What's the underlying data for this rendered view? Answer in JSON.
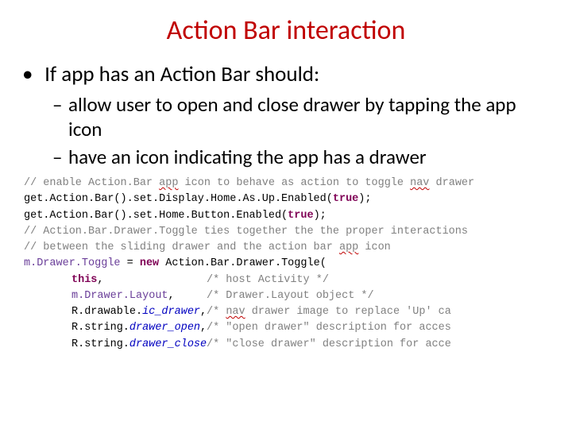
{
  "title": "Action Bar interaction",
  "bullets": {
    "top": "If app has an Action Bar should:",
    "sub": [
      "allow user to open and close drawer by tapping the app icon",
      "have an icon indicating the app has a drawer"
    ]
  },
  "code": {
    "c1a": "// enable Action.Bar ",
    "c1b": "app",
    "c1c": " icon to behave as action to toggle ",
    "c1d": "nav",
    "c1e": " drawer",
    "l2a": "get.Action.Bar().set.Display.Home.As.Up.Enabled(",
    "l2b": "true",
    "l2c": ");",
    "l3a": "get.Action.Bar().set.Home.Button.Enabled(",
    "l3b": "true",
    "l3c": ");",
    "blank": " ",
    "c4": "// Action.Bar.Drawer.Toggle ties together the the proper interactions",
    "c5a": "// between the sliding drawer and the action bar ",
    "c5b": "app",
    "c5c": " icon",
    "l6a": "m.Drawer.Toggle",
    "l6b": " = ",
    "l6c": "new",
    "l6d": " Action.Bar.Drawer.Toggle(",
    "l7a": "this",
    "l7b": ",",
    "l7c": "/* host Activity */",
    "l8a": "m.Drawer.Layout",
    "l8b": ",",
    "l8c": "/* Drawer.Layout object */",
    "l9a": "R.drawable.",
    "l9b": "ic_drawer",
    "l9c": ",",
    "l9d_a": "/* ",
    "l9d_b": "nav",
    "l9d_c": " drawer image to replace 'Up' ca",
    "l10a": "R.string.",
    "l10b": "drawer_open",
    "l10c": ",",
    "l10d": "/* \"open drawer\" description for acces",
    "l11a": "R.string.",
    "l11b": "drawer_close",
    "l11d": "/* \"close drawer\" description for acce"
  }
}
